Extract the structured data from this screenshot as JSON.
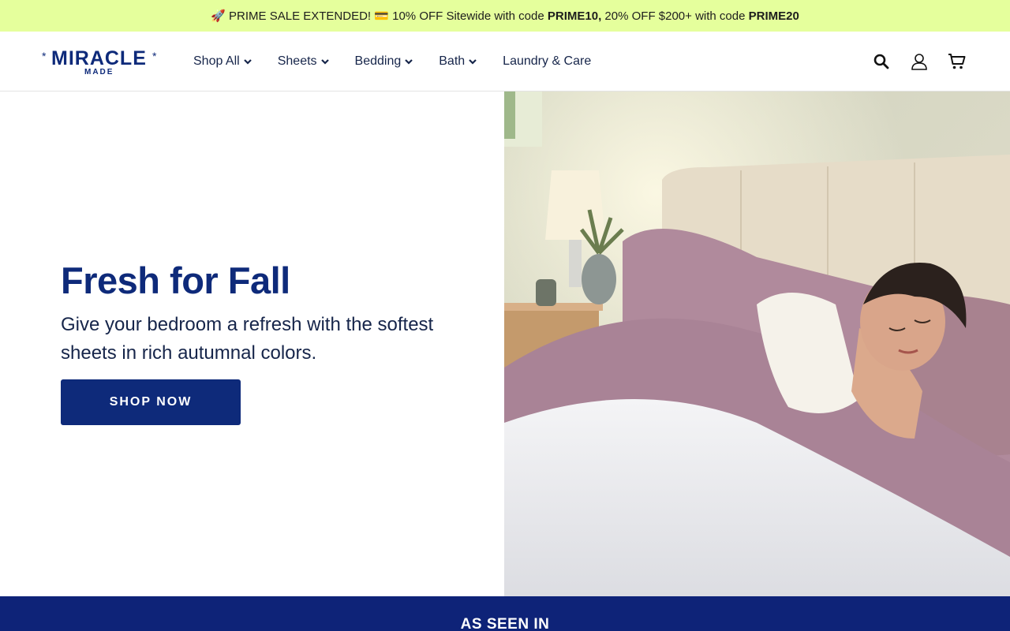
{
  "promo": {
    "emoji_rocket": "🚀",
    "text1": "PRIME SALE EXTENDED!",
    "emoji_card": "💳",
    "text2": "10% OFF Sitewide with code",
    "code1": "PRIME10,",
    "text3": "20% OFF $200+ with code",
    "code2": "PRIME20"
  },
  "brand": {
    "name": "MIRACLE",
    "sub": "MADE",
    "star": "*",
    "color": "#0e2a7a"
  },
  "nav": {
    "items": [
      {
        "label": "Shop All",
        "has_dropdown": true
      },
      {
        "label": "Sheets",
        "has_dropdown": true
      },
      {
        "label": "Bedding",
        "has_dropdown": true
      },
      {
        "label": "Bath",
        "has_dropdown": true
      },
      {
        "label": "Laundry & Care",
        "has_dropdown": false
      }
    ]
  },
  "header_icons": [
    "search-icon",
    "account-icon",
    "cart-icon"
  ],
  "hero": {
    "title": "Fresh for Fall",
    "subtitle": "Give your bedroom a refresh with the softest sheets in rich autumnal colors.",
    "cta": "SHOP NOW"
  },
  "as_seen_in": {
    "title": "AS SEEN IN"
  },
  "colors": {
    "promo_bg": "#e5ff9c",
    "accent": "#0e2a7a",
    "band": "#0e2378"
  }
}
